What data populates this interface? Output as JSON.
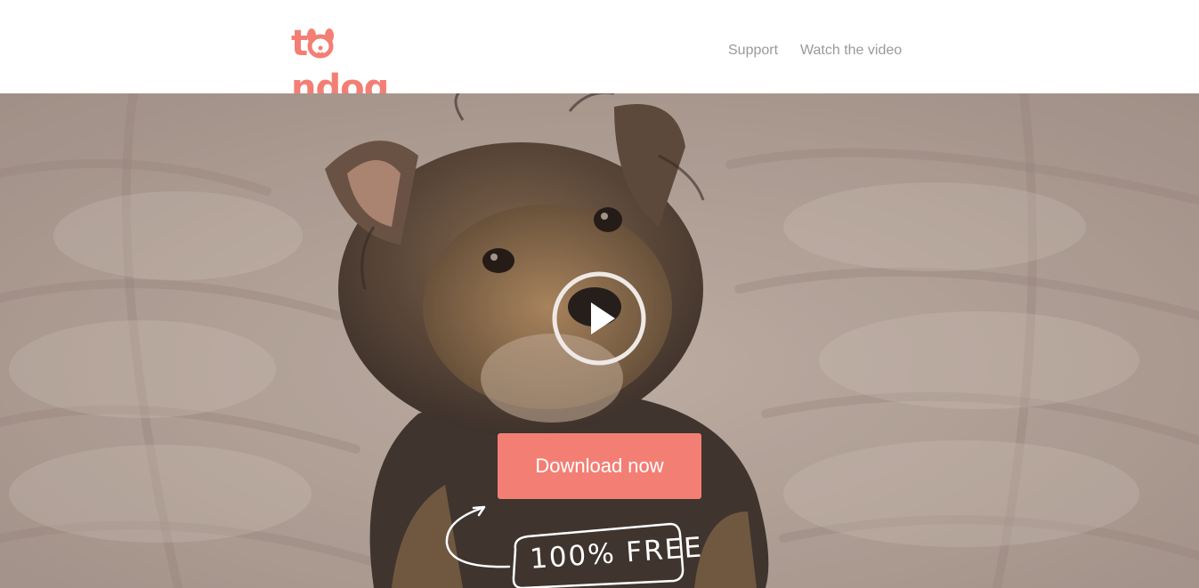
{
  "brand": {
    "name_prefix": "t",
    "name_suffix": "ndog",
    "color": "#f37f74"
  },
  "nav": {
    "support": "Support",
    "watch_video": "Watch the video"
  },
  "hero": {
    "download_label": "Download now",
    "free_label": "100% FREE",
    "button_color": "#f37f74",
    "play_icon": "play-icon"
  }
}
